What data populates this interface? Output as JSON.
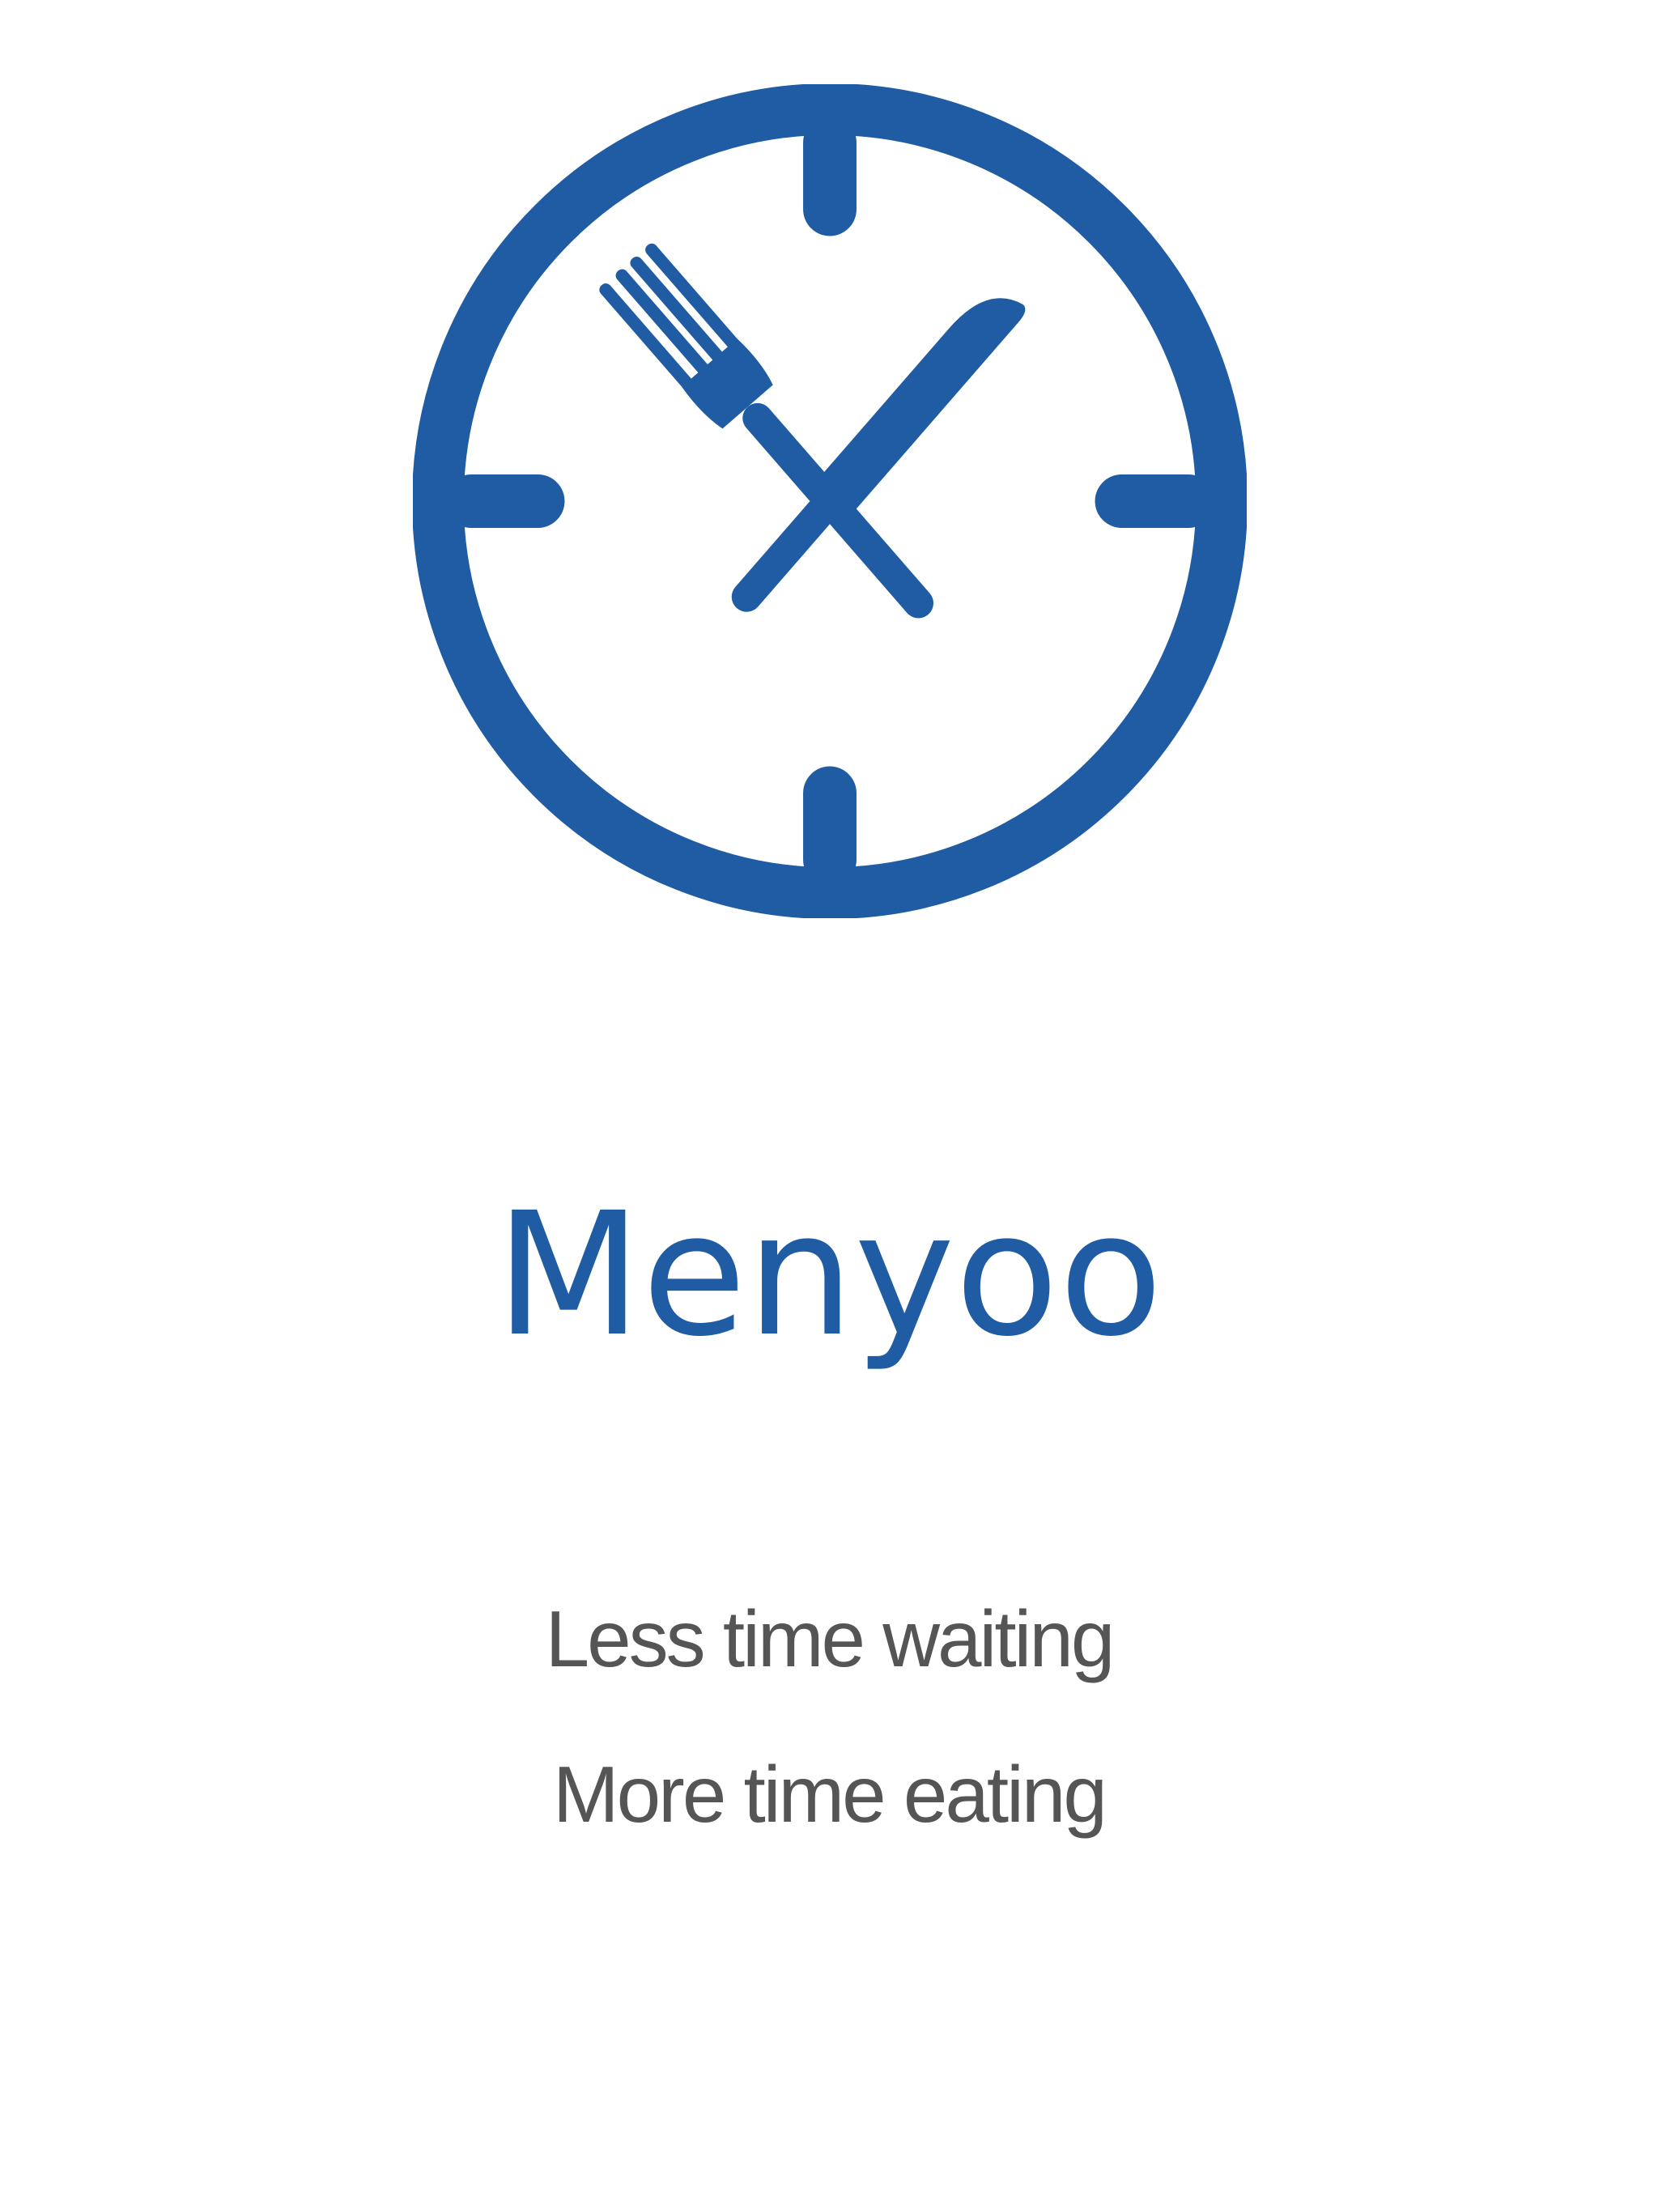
{
  "splash": {
    "logo_icon": "clock-fork-knife-icon",
    "app_name": "Menyoo",
    "tagline_line1": "Less time waiting",
    "tagline_line2": "More time eating"
  },
  "colors": {
    "brand": "#1f5ca3",
    "tagline": "#555555",
    "background": "#ffffff"
  }
}
